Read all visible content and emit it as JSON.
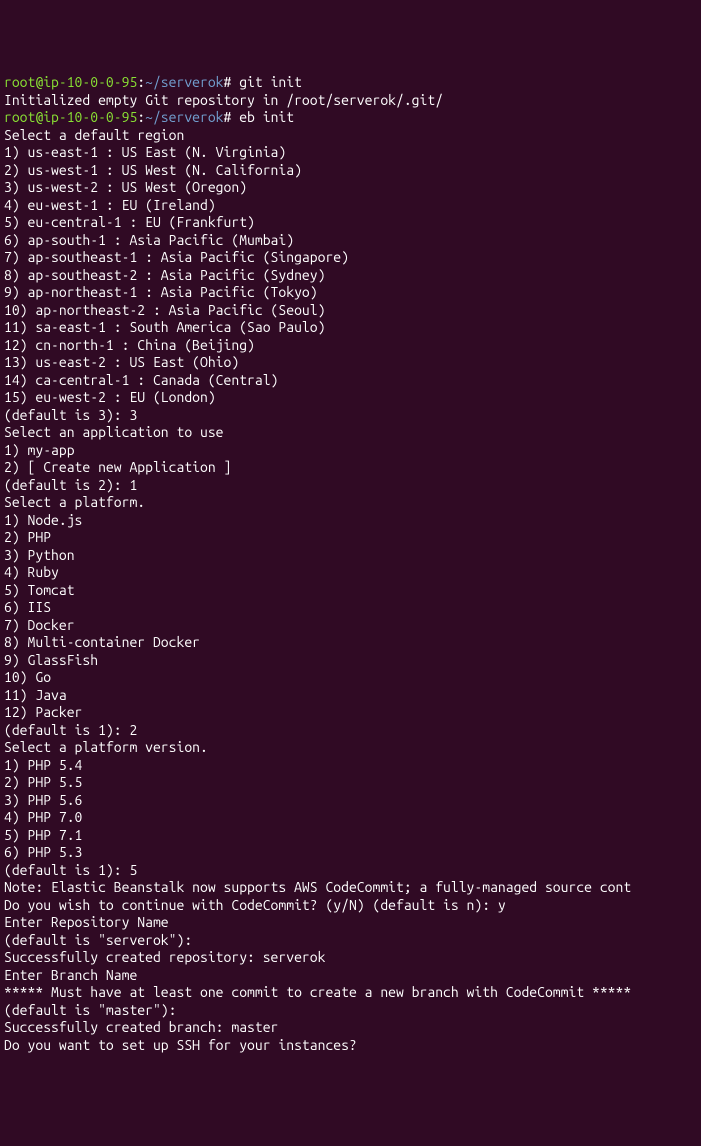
{
  "prompt1": {
    "user_host": "root@ip-10-0-0-95",
    "sep1": ":",
    "path": "~/serverok",
    "sep2": "#",
    "command": " git init"
  },
  "line2": "Initialized empty Git repository in /root/serverok/.git/",
  "prompt2": {
    "user_host": "root@ip-10-0-0-95",
    "sep1": ":",
    "path": "~/serverok",
    "sep2": "#",
    "command": " eb init"
  },
  "blank1": "",
  "region_header": "Select a default region",
  "region_options": [
    "1) us-east-1 : US East (N. Virginia)",
    "2) us-west-1 : US West (N. California)",
    "3) us-west-2 : US West (Oregon)",
    "4) eu-west-1 : EU (Ireland)",
    "5) eu-central-1 : EU (Frankfurt)",
    "6) ap-south-1 : Asia Pacific (Mumbai)",
    "7) ap-southeast-1 : Asia Pacific (Singapore)",
    "8) ap-southeast-2 : Asia Pacific (Sydney)",
    "9) ap-northeast-1 : Asia Pacific (Tokyo)",
    "10) ap-northeast-2 : Asia Pacific (Seoul)",
    "11) sa-east-1 : South America (Sao Paulo)",
    "12) cn-north-1 : China (Beijing)",
    "13) us-east-2 : US East (Ohio)",
    "14) ca-central-1 : Canada (Central)",
    "15) eu-west-2 : EU (London)"
  ],
  "region_default": "(default is 3): 3",
  "blank2": "",
  "app_header": "Select an application to use",
  "app_options": [
    "1) my-app",
    "2) [ Create new Application ]"
  ],
  "app_default": "(default is 2): 1",
  "blank3": "",
  "platform_header": "Select a platform.",
  "platform_options": [
    "1) Node.js",
    "2) PHP",
    "3) Python",
    "4) Ruby",
    "5) Tomcat",
    "6) IIS",
    "7) Docker",
    "8) Multi-container Docker",
    "9) GlassFish",
    "10) Go",
    "11) Java",
    "12) Packer"
  ],
  "platform_default": "(default is 1): 2",
  "blank4": "",
  "version_header": "Select a platform version.",
  "version_options": [
    "1) PHP 5.4",
    "2) PHP 5.5",
    "3) PHP 5.6",
    "4) PHP 7.0",
    "5) PHP 7.1",
    "6) PHP 5.3"
  ],
  "version_default": "(default is 1): 5",
  "note_line": "Note: Elastic Beanstalk now supports AWS CodeCommit; a fully-managed source cont",
  "codecommit_q": "Do you wish to continue with CodeCommit? (y/N) (default is n): y",
  "blank5": "",
  "repo_header": "Enter Repository Name",
  "repo_default": "(default is \"serverok\"):",
  "repo_success": "Successfully created repository: serverok",
  "blank6": "",
  "branch_header": "Enter Branch Name",
  "branch_warn": "***** Must have at least one commit to create a new branch with CodeCommit *****",
  "branch_default": "(default is \"master\"):",
  "branch_success": "Successfully created branch: master",
  "ssh_q": "Do you want to set up SSH for your instances?"
}
